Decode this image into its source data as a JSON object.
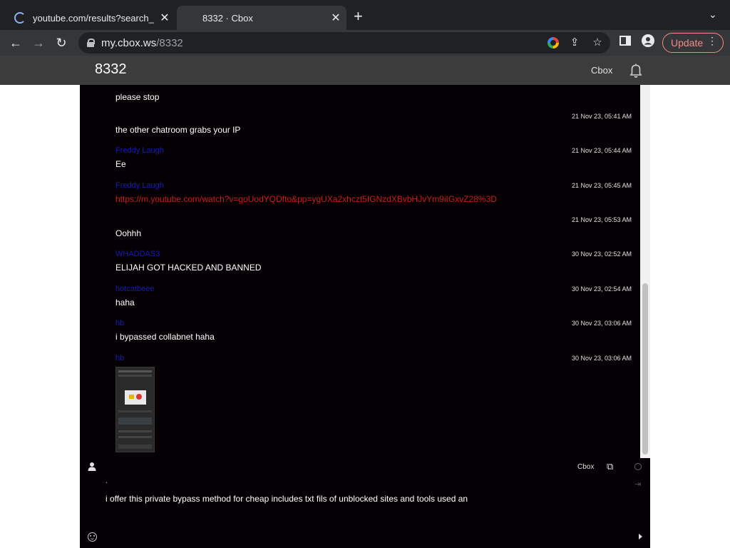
{
  "browser": {
    "tabs": [
      {
        "title": "youtube.com/results?search_q",
        "loading": true
      },
      {
        "title": "8332 · Cbox",
        "active": true
      }
    ],
    "new_tab_label": "+",
    "close_label": "✕",
    "tab_menu_label": "⌄",
    "url_host": "my.cbox.ws",
    "url_path": "/8332",
    "update_label": "Update"
  },
  "site": {
    "room_title": "8332",
    "brand": "Cbox"
  },
  "messages": [
    {
      "user": "",
      "time": "",
      "text": "please stop"
    },
    {
      "user": "",
      "time": "21 Nov 23, 05:41 AM",
      "text": "the other chatroom grabs your IP"
    },
    {
      "user": "Freddy Laugh",
      "time": "21 Nov 23, 05:44 AM",
      "text": "Ee"
    },
    {
      "user": "Freddy Laugh",
      "time": "21 Nov 23, 05:45 AM",
      "link": "https://m.youtube.com/watch?v=goUodYQDfto&pp=ygUXa2xhczt5IGNzdXBvbHJvYm9iIGxvZ28%3D"
    },
    {
      "user": "",
      "time": "21 Nov 23, 05:53 AM",
      "text": "Oohhh"
    },
    {
      "user": "WHADDAS3",
      "time": "30 Nov 23, 02:52 AM",
      "text": "ELIJAH GOT HACKED AND BANNED"
    },
    {
      "user": "hotcatbeee",
      "time": "30 Nov 23, 02:54 AM",
      "text": "haha"
    },
    {
      "user": "hb",
      "time": "30 Nov 23, 03:06 AM",
      "text": "i bypassed collabnet haha"
    },
    {
      "user": "hb",
      "time": "30 Nov 23, 03:06 AM",
      "image": true
    }
  ],
  "composer": {
    "brand": "Cbox",
    "name_value": ".",
    "message_value": "i offer this private bypass method for cheap includes txt fils of unblocked sites and tools used an"
  },
  "colors": {
    "chat_bg": "#050003",
    "username": "#1a1ab8",
    "link": "#d01a1a",
    "header_bg": "#3c3c3c"
  }
}
